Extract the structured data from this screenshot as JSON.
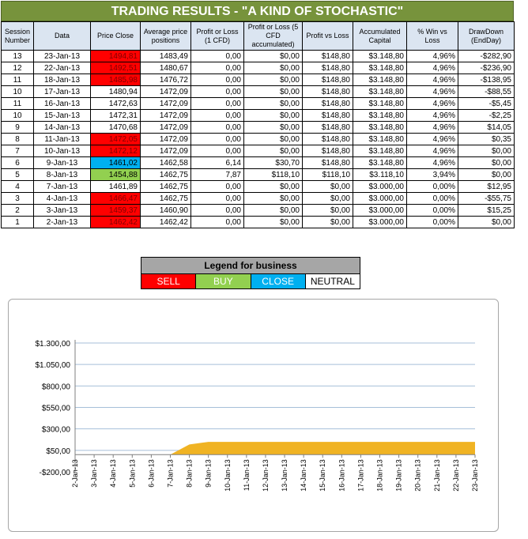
{
  "title": "TRADING RESULTS - \"A KIND OF STOCHASTIC\"",
  "columns": [
    "Session Number",
    "Data",
    "Price Close",
    "Average price positions",
    "Profit or Loss (1 CFD)",
    "Profit or Loss (5 CFD accumulated)",
    "Profit vs Loss",
    "Accumulated Capital",
    "% Win vs Loss",
    "DrawDown (EndDay)"
  ],
  "rows": [
    {
      "session": "13",
      "date": "23-Jan-13",
      "price": "1494,81",
      "signal": "sell",
      "avg": "1483,49",
      "pl1": "0,00",
      "pl5": "$0,00",
      "pvl": "$148,80",
      "capital": "$3.148,80",
      "win": "4,96%",
      "dd": "-$282,90"
    },
    {
      "session": "12",
      "date": "22-Jan-13",
      "price": "1492,51",
      "signal": "sell",
      "avg": "1480,67",
      "pl1": "0,00",
      "pl5": "$0,00",
      "pvl": "$148,80",
      "capital": "$3.148,80",
      "win": "4,96%",
      "dd": "-$236,90"
    },
    {
      "session": "11",
      "date": "18-Jan-13",
      "price": "1485,98",
      "signal": "sell",
      "avg": "1476,72",
      "pl1": "0,00",
      "pl5": "$0,00",
      "pvl": "$148,80",
      "capital": "$3.148,80",
      "win": "4,96%",
      "dd": "-$138,95"
    },
    {
      "session": "10",
      "date": "17-Jan-13",
      "price": "1480,94",
      "signal": "neutral",
      "avg": "1472,09",
      "pl1": "0,00",
      "pl5": "$0,00",
      "pvl": "$148,80",
      "capital": "$3.148,80",
      "win": "4,96%",
      "dd": "-$88,55"
    },
    {
      "session": "11",
      "date": "16-Jan-13",
      "price": "1472,63",
      "signal": "neutral",
      "avg": "1472,09",
      "pl1": "0,00",
      "pl5": "$0,00",
      "pvl": "$148,80",
      "capital": "$3.148,80",
      "win": "4,96%",
      "dd": "-$5,45"
    },
    {
      "session": "10",
      "date": "15-Jan-13",
      "price": "1472,31",
      "signal": "neutral",
      "avg": "1472,09",
      "pl1": "0,00",
      "pl5": "$0,00",
      "pvl": "$148,80",
      "capital": "$3.148,80",
      "win": "4,96%",
      "dd": "-$2,25"
    },
    {
      "session": "9",
      "date": "14-Jan-13",
      "price": "1470,68",
      "signal": "neutral",
      "avg": "1472,09",
      "pl1": "0,00",
      "pl5": "$0,00",
      "pvl": "$148,80",
      "capital": "$3.148,80",
      "win": "4,96%",
      "dd": "$14,05"
    },
    {
      "session": "8",
      "date": "11-Jan-13",
      "price": "1472,05",
      "signal": "sell",
      "avg": "1472,09",
      "pl1": "0,00",
      "pl5": "$0,00",
      "pvl": "$148,80",
      "capital": "$3.148,80",
      "win": "4,96%",
      "dd": "$0,35"
    },
    {
      "session": "7",
      "date": "10-Jan-13",
      "price": "1472,12",
      "signal": "sell",
      "avg": "1472,09",
      "pl1": "0,00",
      "pl5": "$0,00",
      "pvl": "$148,80",
      "capital": "$3.148,80",
      "win": "4,96%",
      "dd": "$0,00"
    },
    {
      "session": "6",
      "date": "9-Jan-13",
      "price": "1461,02",
      "signal": "close",
      "avg": "1462,58",
      "pl1": "6,14",
      "pl5": "$30,70",
      "pvl": "$148,80",
      "capital": "$3.148,80",
      "win": "4,96%",
      "dd": "$0,00"
    },
    {
      "session": "5",
      "date": "8-Jan-13",
      "price": "1454,88",
      "signal": "buy",
      "avg": "1462,75",
      "pl1": "7,87",
      "pl5": "$118,10",
      "pvl": "$118,10",
      "capital": "$3.118,10",
      "win": "3,94%",
      "dd": "$0,00"
    },
    {
      "session": "4",
      "date": "7-Jan-13",
      "price": "1461,89",
      "signal": "neutral",
      "avg": "1462,75",
      "pl1": "0,00",
      "pl5": "$0,00",
      "pvl": "$0,00",
      "capital": "$3.000,00",
      "win": "0,00%",
      "dd": "$12,95"
    },
    {
      "session": "3",
      "date": "4-Jan-13",
      "price": "1466,47",
      "signal": "sell",
      "avg": "1462,75",
      "pl1": "0,00",
      "pl5": "$0,00",
      "pvl": "$0,00",
      "capital": "$3.000,00",
      "win": "0,00%",
      "dd": "-$55,75"
    },
    {
      "session": "2",
      "date": "3-Jan-13",
      "price": "1459,37",
      "signal": "sell",
      "avg": "1460,90",
      "pl1": "0,00",
      "pl5": "$0,00",
      "pvl": "$0,00",
      "capital": "$3.000,00",
      "win": "0,00%",
      "dd": "$15,25"
    },
    {
      "session": "1",
      "date": "2-Jan-13",
      "price": "1462,42",
      "signal": "sell",
      "avg": "1462,42",
      "pl1": "0,00",
      "pl5": "$0,00",
      "pvl": "$0,00",
      "capital": "$3.000,00",
      "win": "0,00%",
      "dd": "$0,00"
    }
  ],
  "legend": {
    "title": "Legend for business",
    "items": [
      {
        "label": "SELL",
        "color": "#ff0000",
        "text_color": "#ffffff"
      },
      {
        "label": "BUY",
        "color": "#92d050",
        "text_color": "#ffffff"
      },
      {
        "label": "CLOSE",
        "color": "#00b0f0",
        "text_color": "#ffffff"
      },
      {
        "label": "NEUTRAL",
        "color": "#ffffff",
        "text_color": "#000000"
      }
    ]
  },
  "colors": {
    "sell": "#ff0000",
    "buy": "#92d050",
    "close": "#00b0f0",
    "header_bg": "#77933c",
    "area_fill": "#f0b323"
  },
  "chart_data": {
    "type": "area",
    "title": "",
    "xlabel": "",
    "ylabel": "",
    "ylim": [
      -200,
      1300
    ],
    "yticks": [
      "-$200,00",
      "$50,00",
      "$300,00",
      "$550,00",
      "$800,00",
      "$1.050,00",
      "$1.300,00"
    ],
    "ytick_values": [
      -200,
      50,
      300,
      550,
      800,
      1050,
      1300
    ],
    "grid": true,
    "categories": [
      "2-Jan-13",
      "3-Jan-13",
      "4-Jan-13",
      "5-Jan-13",
      "6-Jan-13",
      "7-Jan-13",
      "8-Jan-13",
      "9-Jan-13",
      "10-Jan-13",
      "11-Jan-13",
      "12-Jan-13",
      "13-Jan-13",
      "14-Jan-13",
      "15-Jan-13",
      "16-Jan-13",
      "17-Jan-13",
      "18-Jan-13",
      "19-Jan-13",
      "20-Jan-13",
      "21-Jan-13",
      "22-Jan-13",
      "23-Jan-13"
    ],
    "values": [
      0,
      0,
      0,
      0,
      0,
      0,
      118.1,
      148.8,
      148.8,
      148.8,
      148.8,
      148.8,
      148.8,
      148.8,
      148.8,
      148.8,
      148.8,
      148.8,
      148.8,
      148.8,
      148.8,
      148.8
    ]
  }
}
